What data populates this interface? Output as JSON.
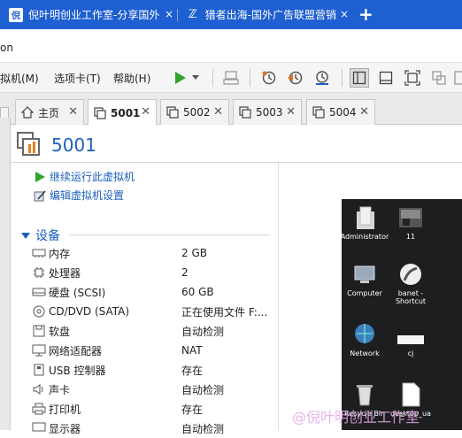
{
  "browser": {
    "tabs": [
      {
        "favicon": "倪",
        "title": "倪叶明创业工作室-分享国外",
        "close": "×"
      },
      {
        "favicon": "ℤ",
        "title": "猎者出海-国外广告联盟营销",
        "close": "×"
      }
    ],
    "new_tab": "+",
    "address_fragment": "on"
  },
  "toolbar": {
    "menus": [
      "拟机(M)",
      "选项卡(T)",
      "帮助(H)"
    ],
    "icons": [
      "play-icon",
      "dropdown-arrow-icon",
      "send-ctrl-alt-del-icon",
      "snapshot-icon",
      "revert-snapshot-icon",
      "snapshot-manager-icon",
      "sidebar-view-icon",
      "console-view-icon",
      "fullscreen-icon",
      "unity-icon",
      "stretch-icon"
    ]
  },
  "vm_tabs": [
    {
      "label": "主页",
      "icon": "home-icon",
      "active": false
    },
    {
      "label": "5001",
      "icon": "vm-icon",
      "active": true
    },
    {
      "label": "5002",
      "icon": "vm-icon",
      "active": false
    },
    {
      "label": "5003",
      "icon": "vm-icon",
      "active": false
    },
    {
      "label": "5004",
      "icon": "vm-icon",
      "active": false
    }
  ],
  "vm": {
    "title": "5001",
    "actions": [
      "继续运行此虚拟机",
      "编辑虚拟机设置"
    ],
    "section_title": "设备",
    "devices": [
      {
        "name": "内存",
        "value": "2 GB",
        "icon": "memory-icon"
      },
      {
        "name": "处理器",
        "value": "2",
        "icon": "cpu-icon"
      },
      {
        "name": "硬盘 (SCSI)",
        "value": "60 GB",
        "icon": "hard-disk-icon"
      },
      {
        "name": "CD/DVD (SATA)",
        "value": "正在使用文件 F:...",
        "icon": "cd-dvd-icon"
      },
      {
        "name": "软盘",
        "value": "自动检测",
        "icon": "floppy-icon"
      },
      {
        "name": "网络适配器",
        "value": "NAT",
        "icon": "network-adapter-icon"
      },
      {
        "name": "USB 控制器",
        "value": "存在",
        "icon": "usb-icon"
      },
      {
        "name": "声卡",
        "value": "自动检测",
        "icon": "sound-card-icon"
      },
      {
        "name": "打印机",
        "value": "存在",
        "icon": "printer-icon"
      },
      {
        "name": "显示器",
        "value": "自动检测",
        "icon": "display-icon"
      }
    ]
  },
  "desktop_preview": {
    "icons": [
      {
        "label": "Administrator",
        "icon": "user-folder-icon"
      },
      {
        "label": "11",
        "icon": "picture-file-icon"
      },
      {
        "label": "Computer",
        "icon": "computer-icon"
      },
      {
        "label": "banet - Shortcut",
        "icon": "shortcut-icon"
      },
      {
        "label": "Network",
        "icon": "network-icon"
      },
      {
        "label": "cj",
        "icon": "text-file-icon"
      },
      {
        "label": "Recycle Bin",
        "icon": "recycle-bin-icon"
      },
      {
        "label": "desktop_ua",
        "icon": "file-icon"
      }
    ]
  },
  "watermark": "@倪叶明创业工作室",
  "colors": {
    "browser_bar": "#1e5fd1",
    "accent": "#1b5fbf",
    "play": "#2fa52f"
  }
}
